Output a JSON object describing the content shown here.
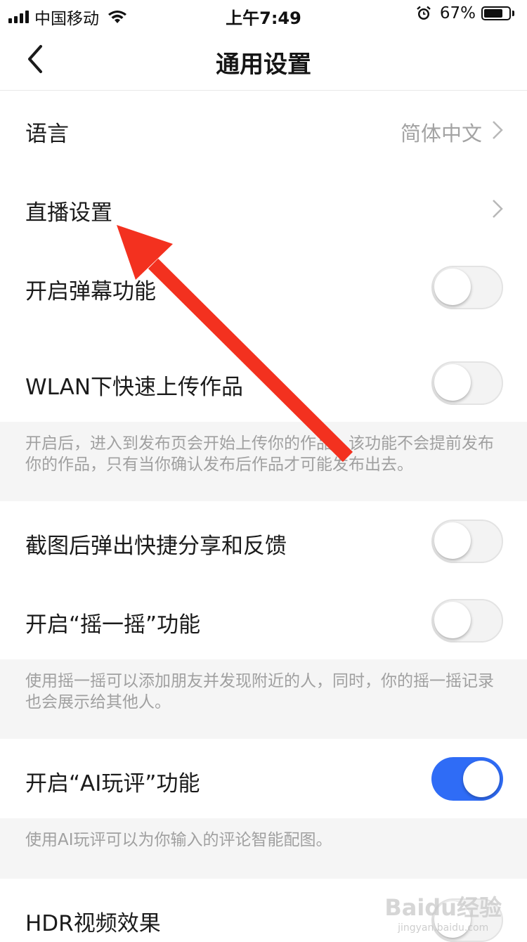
{
  "status_bar": {
    "carrier": "中国移动",
    "time": "上午7:49",
    "battery": "67%"
  },
  "nav": {
    "title": "通用设置"
  },
  "rows": {
    "language": {
      "label": "语言",
      "value": "简体中文"
    },
    "live": {
      "label": "直播设置"
    },
    "danmaku": {
      "label": "开启弹幕功能",
      "on": false
    },
    "wlan": {
      "label": "WLAN下快速上传作品",
      "on": false
    },
    "screenshot": {
      "label": "截图后弹出快捷分享和反馈",
      "on": false
    },
    "shake": {
      "label": "开启“摇一摇”功能",
      "on": false
    },
    "ai_comment": {
      "label": "开启“AI玩评”功能",
      "on": true
    },
    "hdr": {
      "label": "HDR视频效果",
      "on": false
    }
  },
  "notes": {
    "wlan": "开启后，进入到发布页会开始上传你的作品；该功能不会提前发布你的作品，只有当你确认发布后作品才可能发布出去。",
    "shake": "使用摇一摇可以添加朋友并发现附近的人，同时，你的摇一摇记录也会展示给其他人。",
    "ai_comment": "使用AI玩评可以为你输入的评论智能配图。"
  },
  "watermark": {
    "main": "Baidu经验",
    "sub": "jingyan.baidu.com"
  },
  "colors": {
    "accent": "#2f6cf6",
    "annotation_arrow": "#f3311f"
  }
}
